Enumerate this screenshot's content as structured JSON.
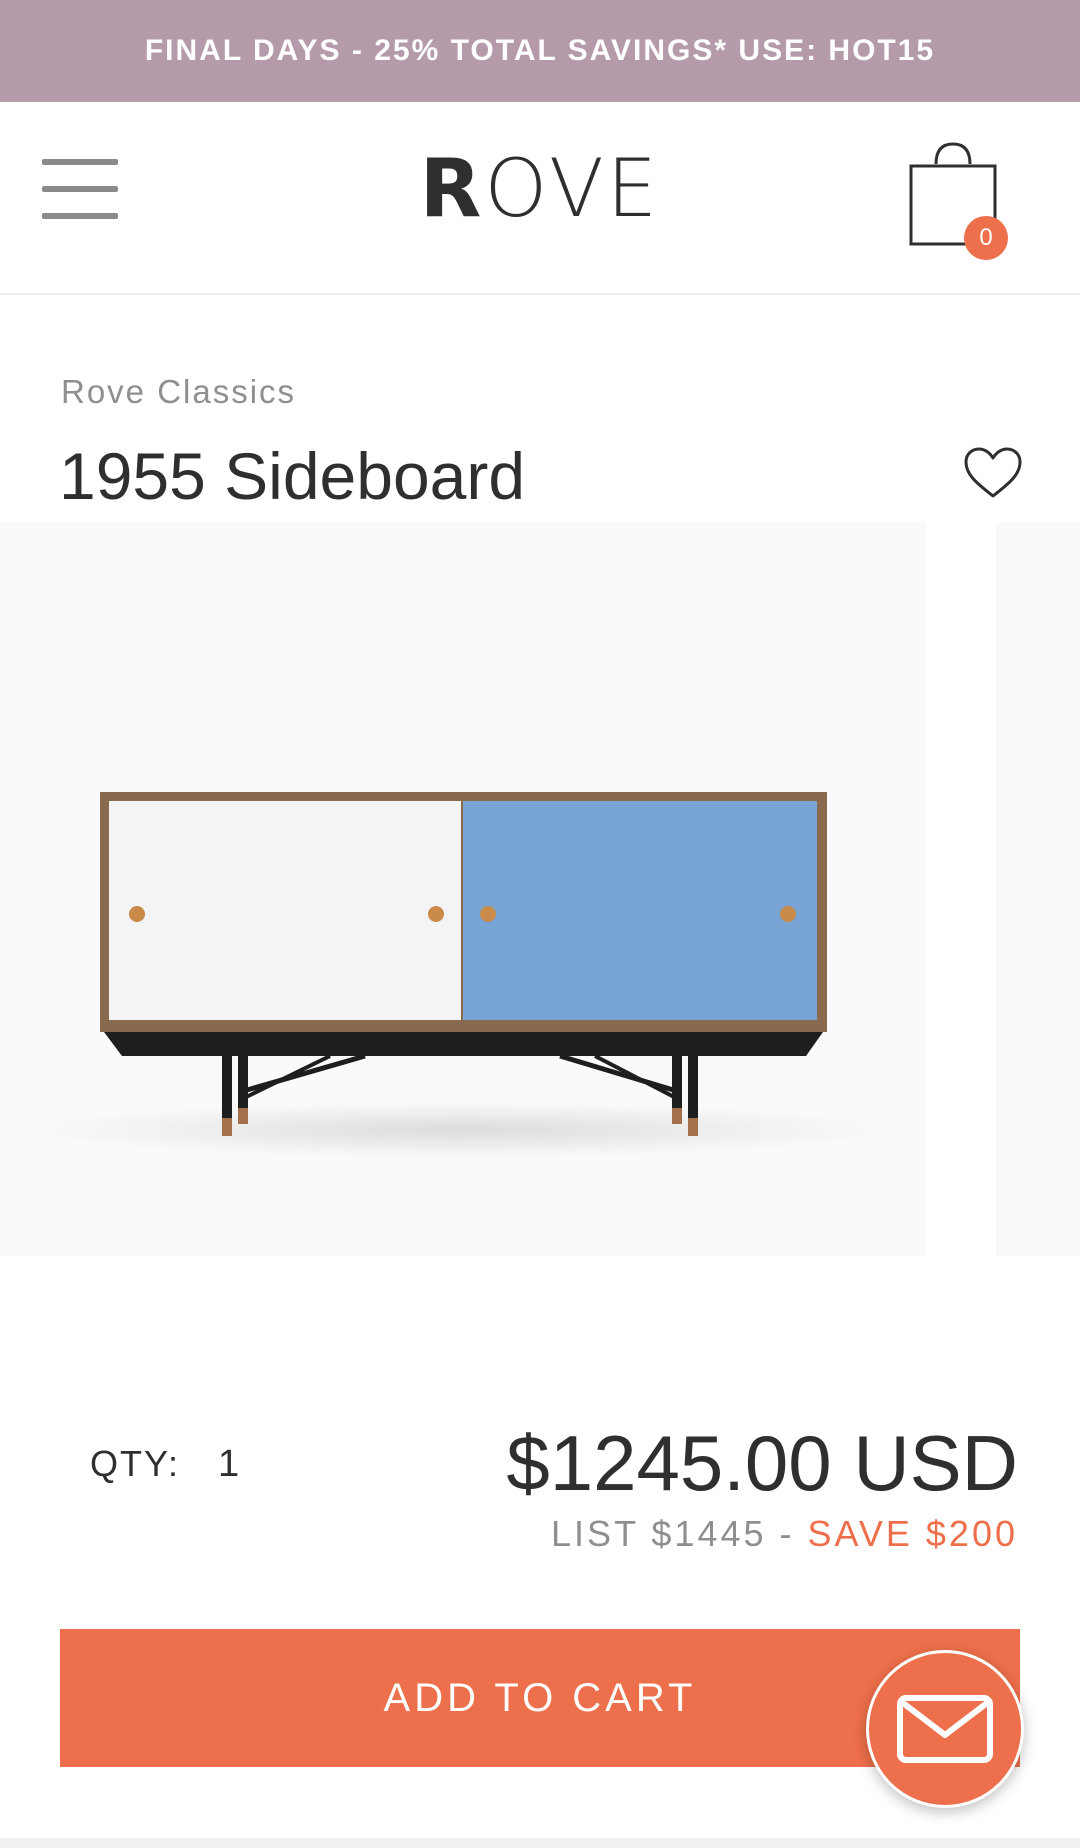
{
  "promo": {
    "text": "FINAL DAYS - 25% TOTAL SAVINGS* USE: HOT15"
  },
  "header": {
    "logo_bold": "R",
    "logo_rest": "OVE",
    "cart_count": "0",
    "menu_icon": "hamburger-icon",
    "cart_icon": "shopping-bag-icon"
  },
  "product": {
    "brand": "Rove Classics",
    "title": "1955 Sideboard",
    "wishlist_icon": "heart-icon",
    "image": "sideboard-white-blue-doors"
  },
  "purchase": {
    "qty_label": "QTY:",
    "qty_value": "1",
    "price": "$1245.00 USD",
    "list_price": "LIST $1445 -",
    "save_amount": "SAVE $200",
    "add_to_cart_label": "ADD TO CART",
    "chat_icon": "envelope-icon"
  },
  "colors": {
    "promo_bg": "#b59ba9",
    "accent": "#ee6f4b",
    "text": "#2f2f2f",
    "muted": "#8f8f8f"
  }
}
